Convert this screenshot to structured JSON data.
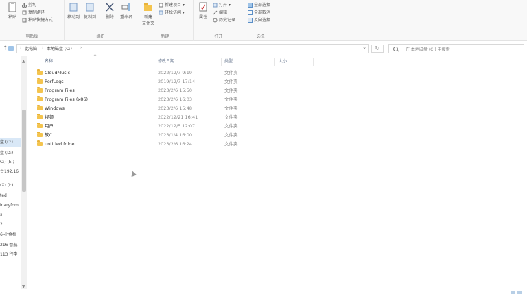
{
  "ribbon": {
    "clipboard": {
      "label": "剪贴板",
      "paste": "粘贴",
      "cut": "剪切",
      "copy_path": "复制路径",
      "paste_shortcut": "粘贴快捷方式"
    },
    "organize": {
      "label": "组织",
      "move_to": "移动到",
      "copy_to": "复制到",
      "delete": "删除",
      "rename": "重命名"
    },
    "new": {
      "label": "新建",
      "new_folder": "新建\n文件夹",
      "new_item": "新建项目 ▾",
      "easy_access": "轻松访问 ▾"
    },
    "open": {
      "label": "打开",
      "properties": "属性",
      "open": "打开 ▾",
      "edit": "编辑",
      "history": "历史记录"
    },
    "select": {
      "label": "选择",
      "select_all": "全部选择",
      "select_none": "全部取消",
      "invert": "反向选择"
    }
  },
  "address": {
    "crumb1": "此电脑",
    "crumb2": "本地磁盘 (C:)",
    "search_placeholder": "在 本地磁盘 (C:) 中搜索"
  },
  "nav_pane": {
    "items": [
      "盘 (C:)",
      "盘 (D:)",
      "C:) (E:)",
      "台192.16",
      "(X) (I:)",
      "ted",
      "inaryfom",
      "s",
      "2",
      "6-小金档",
      "216 智航",
      "113 行李"
    ]
  },
  "columns": {
    "name": "名称",
    "date": "修改日期",
    "type": "类型",
    "size": "大小"
  },
  "files": [
    {
      "name": "CloudMusic",
      "date": "2022/12/7 9:19",
      "type": "文件夹"
    },
    {
      "name": "PerfLogs",
      "date": "2019/12/7 17:14",
      "type": "文件夹"
    },
    {
      "name": "Program Files",
      "date": "2023/2/6 15:50",
      "type": "文件夹"
    },
    {
      "name": "Program Files (x86)",
      "date": "2023/2/6 16:03",
      "type": "文件夹"
    },
    {
      "name": "Windows",
      "date": "2023/2/6 15:48",
      "type": "文件夹"
    },
    {
      "name": "视频",
      "date": "2022/12/21 16:41",
      "type": "文件夹"
    },
    {
      "name": "用户",
      "date": "2022/12/5 12:07",
      "type": "文件夹"
    },
    {
      "name": "软C",
      "date": "2023/1/4 16:00",
      "type": "文件夹"
    },
    {
      "name": "untitled folder",
      "date": "2023/2/6 16:24",
      "type": "文件夹"
    }
  ],
  "colors": {
    "folder": "#f4c44e",
    "selection": "#d9e8f7",
    "accent": "#2b79c2"
  }
}
